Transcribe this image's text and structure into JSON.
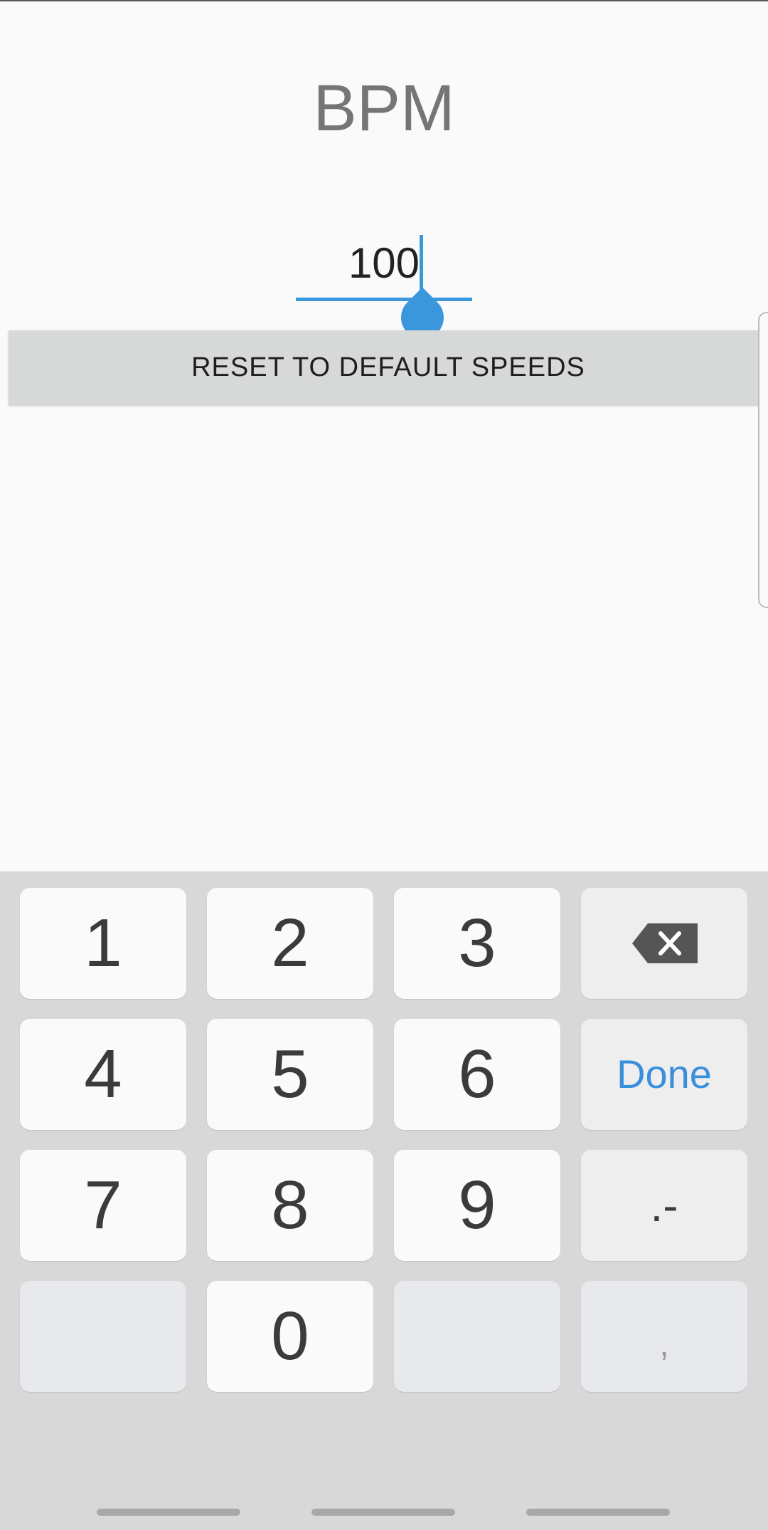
{
  "title": "BPM",
  "bpm_input": {
    "value": "100"
  },
  "reset_button": {
    "label": "RESET TO DEFAULT SPEEDS"
  },
  "keyboard": {
    "keys": {
      "k1": "1",
      "k2": "2",
      "k3": "3",
      "k4": "4",
      "k5": "5",
      "k6": "6",
      "k7": "7",
      "k8": "8",
      "k9": "9",
      "k0": "0",
      "done": "Done",
      "dot_minus": ".-",
      "comma": ","
    }
  },
  "colors": {
    "accent": "#3a97dc",
    "done_text": "#3a8fdc",
    "keyboard_bg": "#d8d8d8"
  },
  "icons": {
    "backspace": "backspace-icon"
  }
}
